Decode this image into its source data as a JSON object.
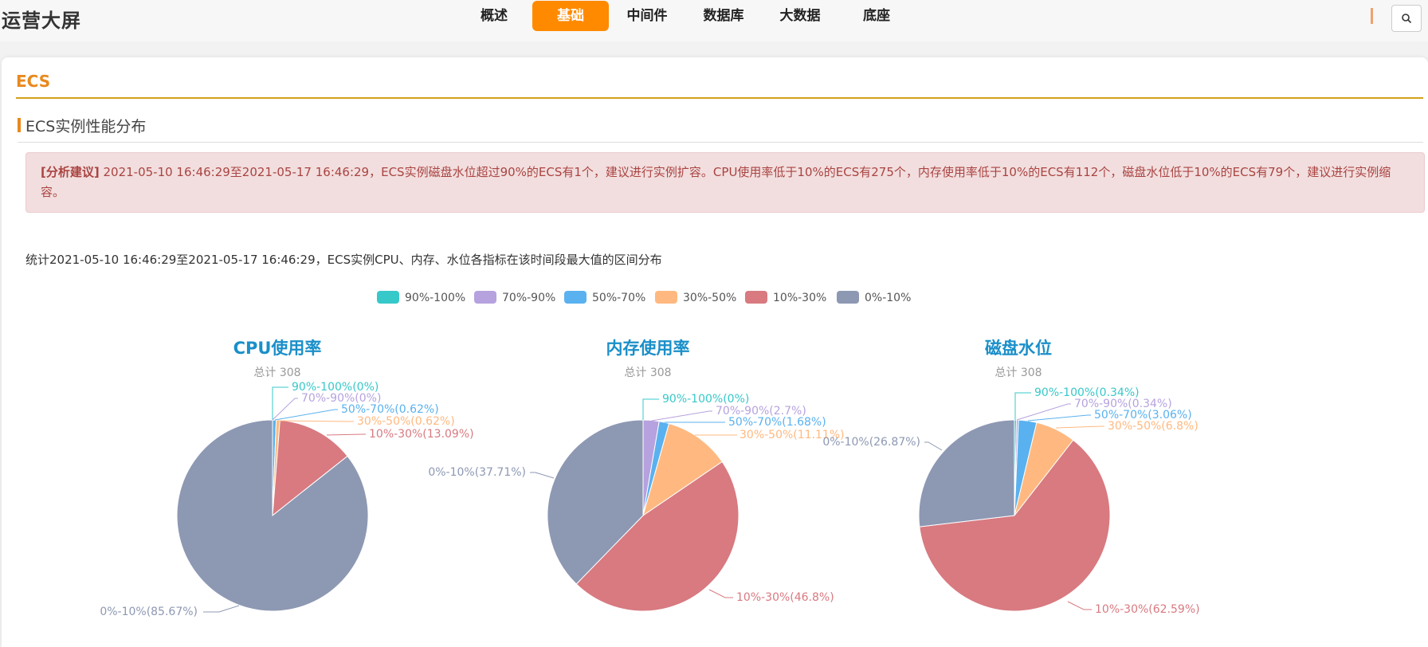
{
  "header": {
    "app_title": "运营大屏",
    "tabs": [
      {
        "label": "概述",
        "active": false
      },
      {
        "label": "基础",
        "active": true
      },
      {
        "label": "中间件",
        "active": false
      },
      {
        "label": "数据库",
        "active": false
      },
      {
        "label": "大数据",
        "active": false
      },
      {
        "label": "底座",
        "active": false
      }
    ],
    "search_icon": "search-icon"
  },
  "section": {
    "title": "ECS",
    "subtitle": "ECS实例性能分布"
  },
  "alert": {
    "tag": "[分析建议]",
    "text": " 2021-05-10 16:46:29至2021-05-17 16:46:29，ECS实例磁盘水位超过90%的ECS有1个，建议进行实例扩容。CPU使用率低于10%的ECS有275个，内存使用率低于10%的ECS有112个，磁盘水位低于10%的ECS有79个，建议进行实例缩容。"
  },
  "stat_text": "统计2021-05-10 16:46:29至2021-05-17 16:46:29，ECS实例CPU、内存、水位各指标在该时间段最大值的区间分布",
  "chart_data": [
    {
      "type": "pie",
      "title": "CPU使用率",
      "subtitle": "总计 308",
      "categories": [
        "90%-100%",
        "70%-90%",
        "50%-70%",
        "30%-50%",
        "10%-30%",
        "0%-10%"
      ],
      "values": [
        0,
        0,
        0.62,
        0.62,
        13.09,
        85.67
      ],
      "colors": [
        "#37c8c9",
        "#b6a2de",
        "#5ab1ef",
        "#ffb980",
        "#d87a80",
        "#8d98b3"
      ],
      "labels": [
        "90%-100%(0%)",
        "70%-90%(0%)",
        "50%-70%(0.62%)",
        "30%-50%(0.62%)",
        "10%-30%(13.09%)",
        "0%-10%(85.67%)"
      ],
      "legend": "top-center"
    },
    {
      "type": "pie",
      "title": "内存使用率",
      "subtitle": "总计 308",
      "categories": [
        "90%-100%",
        "70%-90%",
        "50%-70%",
        "30%-50%",
        "10%-30%",
        "0%-10%"
      ],
      "values": [
        0,
        2.7,
        1.68,
        11.11,
        46.8,
        37.71
      ],
      "colors": [
        "#37c8c9",
        "#b6a2de",
        "#5ab1ef",
        "#ffb980",
        "#d87a80",
        "#8d98b3"
      ],
      "labels": [
        "90%-100%(0%)",
        "70%-90%(2.7%)",
        "50%-70%(1.68%)",
        "30%-50%(11.11%)",
        "10%-30%(46.8%)",
        "0%-10%(37.71%)"
      ],
      "legend": "top-center"
    },
    {
      "type": "pie",
      "title": "磁盘水位",
      "subtitle": "总计 308",
      "categories": [
        "90%-100%",
        "70%-90%",
        "50%-70%",
        "30%-50%",
        "10%-30%",
        "0%-10%"
      ],
      "values": [
        0.34,
        0.34,
        3.06,
        6.8,
        62.59,
        26.87
      ],
      "colors": [
        "#37c8c9",
        "#b6a2de",
        "#5ab1ef",
        "#ffb980",
        "#d87a80",
        "#8d98b3"
      ],
      "labels": [
        "90%-100%(0.34%)",
        "70%-90%(0.34%)",
        "50%-70%(3.06%)",
        "30%-50%(6.8%)",
        "10%-30%(62.59%)",
        "0%-10%(26.87%)"
      ],
      "legend": "top-center"
    }
  ]
}
